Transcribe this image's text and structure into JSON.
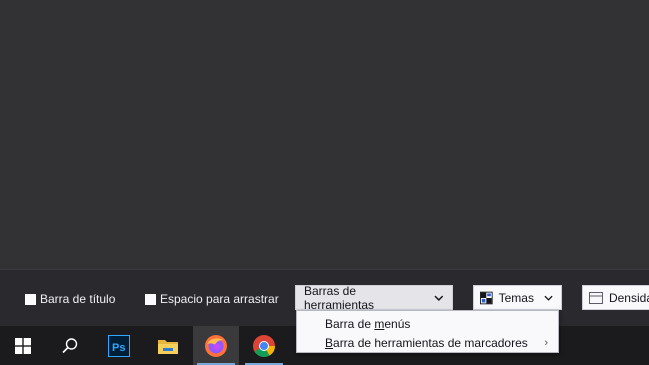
{
  "customize_bar": {
    "title_bar_checkbox_label": "Barra de título",
    "drag_space_checkbox_label": "Espacio para arrastrar",
    "toolbars_dropdown_label": "Barras de herramientas",
    "themes_dropdown_label": "Temas",
    "density_dropdown_label": "Densida"
  },
  "toolbars_menu": {
    "menu_bar": {
      "prefix": "Barra de ",
      "mnemonic": "m",
      "suffix": "enús"
    },
    "bookmarks_toolbar": {
      "prefix": "",
      "mnemonic": "B",
      "suffix": "arra de herramientas de marcadores"
    }
  },
  "taskbar": {
    "apps": [
      {
        "name": "start-icon"
      },
      {
        "name": "search-icon"
      },
      {
        "name": "photoshop-icon",
        "label": "Ps"
      },
      {
        "name": "file-explorer-icon"
      },
      {
        "name": "firefox-icon",
        "active": true
      },
      {
        "name": "chrome-icon",
        "running": true
      }
    ]
  },
  "colors": {
    "photoshop": "#31a8ff",
    "accent_indicator": "#7aa8d6"
  }
}
